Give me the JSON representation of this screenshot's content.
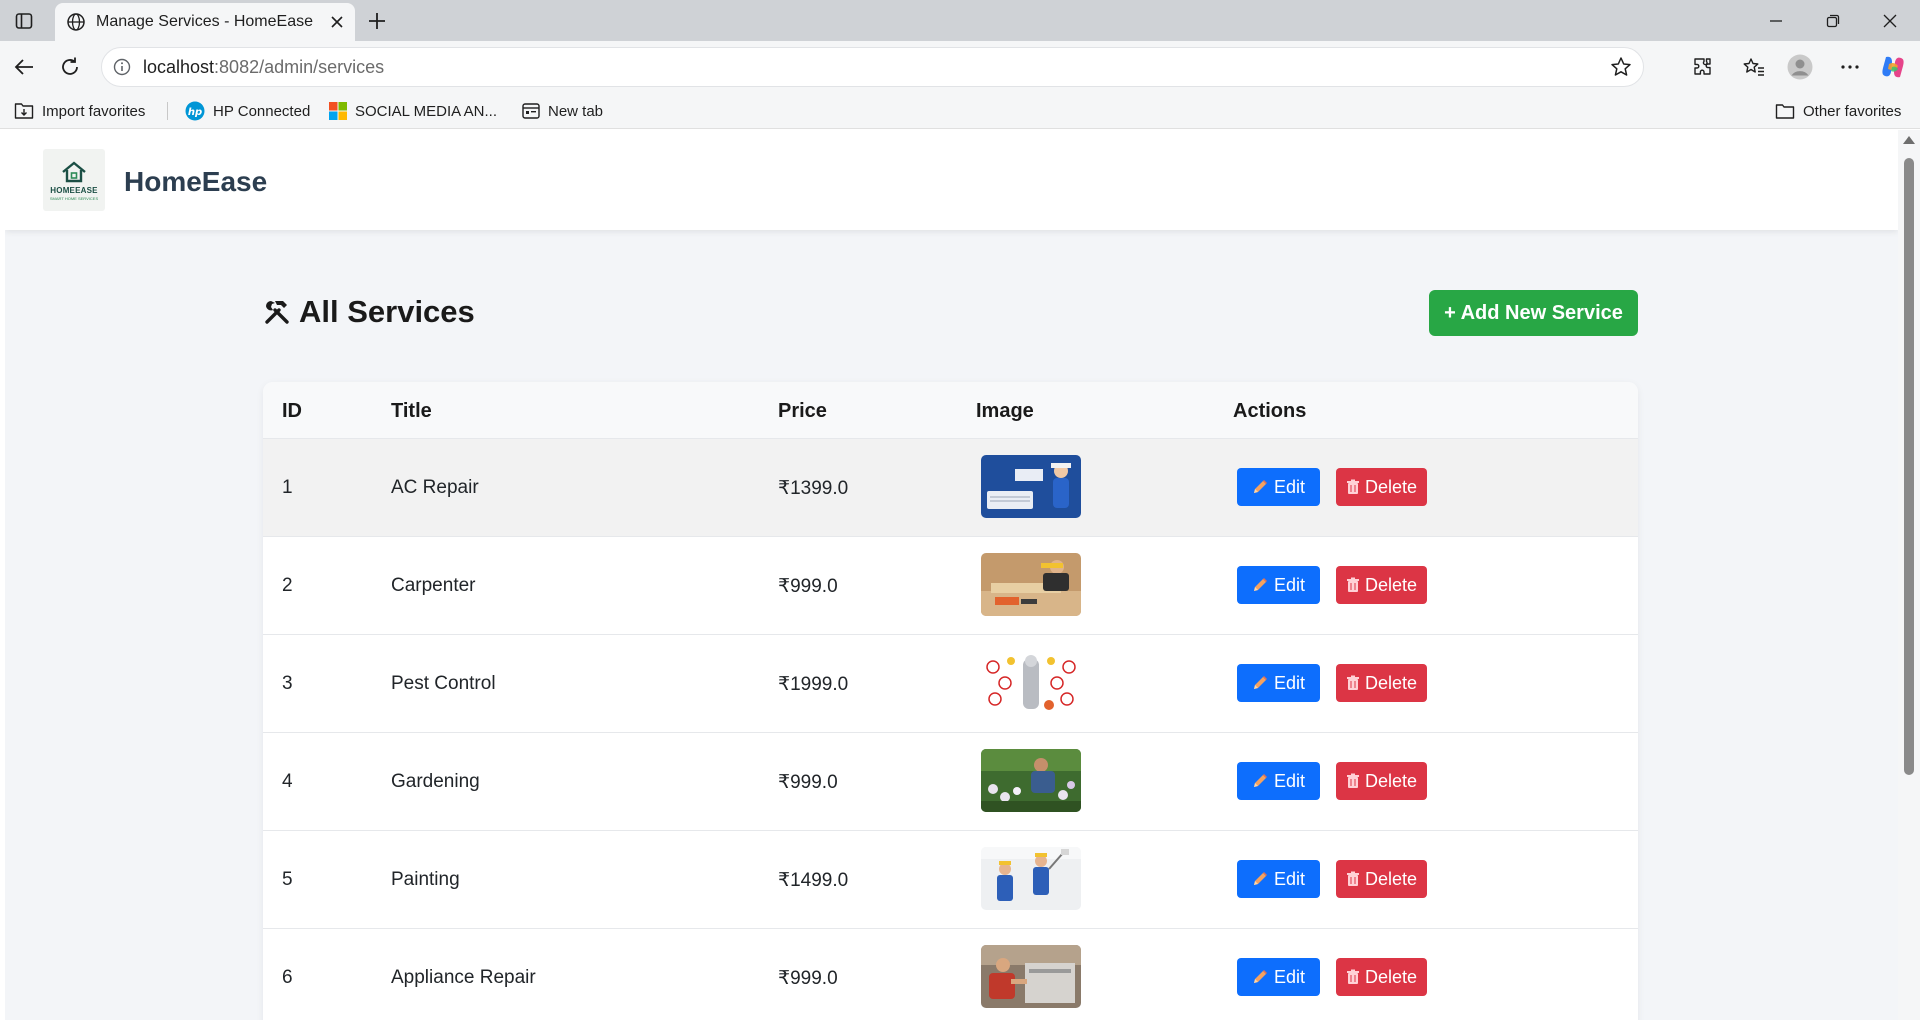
{
  "browser": {
    "tab_title": "Manage Services - HomeEase",
    "url_host": "localhost",
    "url_path": ":8082/admin/services",
    "bookmarks": [
      {
        "label": "Import favorites",
        "icon": "import-favorites-icon"
      },
      {
        "label": "HP Connected",
        "icon": "hp-logo-icon"
      },
      {
        "label": "SOCIAL MEDIA AN...",
        "icon": "microsoft-logo-icon"
      },
      {
        "label": "New tab",
        "icon": "new-tab-page-icon"
      }
    ],
    "other_favorites": "Other favorites"
  },
  "site": {
    "logo_text": "HOMEEASE",
    "logo_subtext": "SMART HOME SERVICES",
    "brand": "HomeEase"
  },
  "page": {
    "heading_icon": "hammer-wrench-icon",
    "title": "All Services",
    "add_button": "+ Add New Service"
  },
  "table": {
    "columns": [
      "ID",
      "Title",
      "Price",
      "Image",
      "Actions"
    ],
    "edit_label": "Edit",
    "delete_label": "Delete",
    "rows": [
      {
        "id": "1",
        "title": "AC Repair",
        "price": "₹1399.0"
      },
      {
        "id": "2",
        "title": "Carpenter",
        "price": "₹999.0"
      },
      {
        "id": "3",
        "title": "Pest Control",
        "price": "₹1999.0"
      },
      {
        "id": "4",
        "title": "Gardening",
        "price": "₹999.0"
      },
      {
        "id": "5",
        "title": "Painting",
        "price": "₹1499.0"
      },
      {
        "id": "6",
        "title": "Appliance Repair",
        "price": "₹999.0"
      }
    ]
  },
  "colors": {
    "add_button": "#28a745",
    "edit_button": "#0d6efd",
    "delete_button": "#dc3545",
    "brand_text": "#2c3e50",
    "page_background": "#f3f5f8"
  }
}
